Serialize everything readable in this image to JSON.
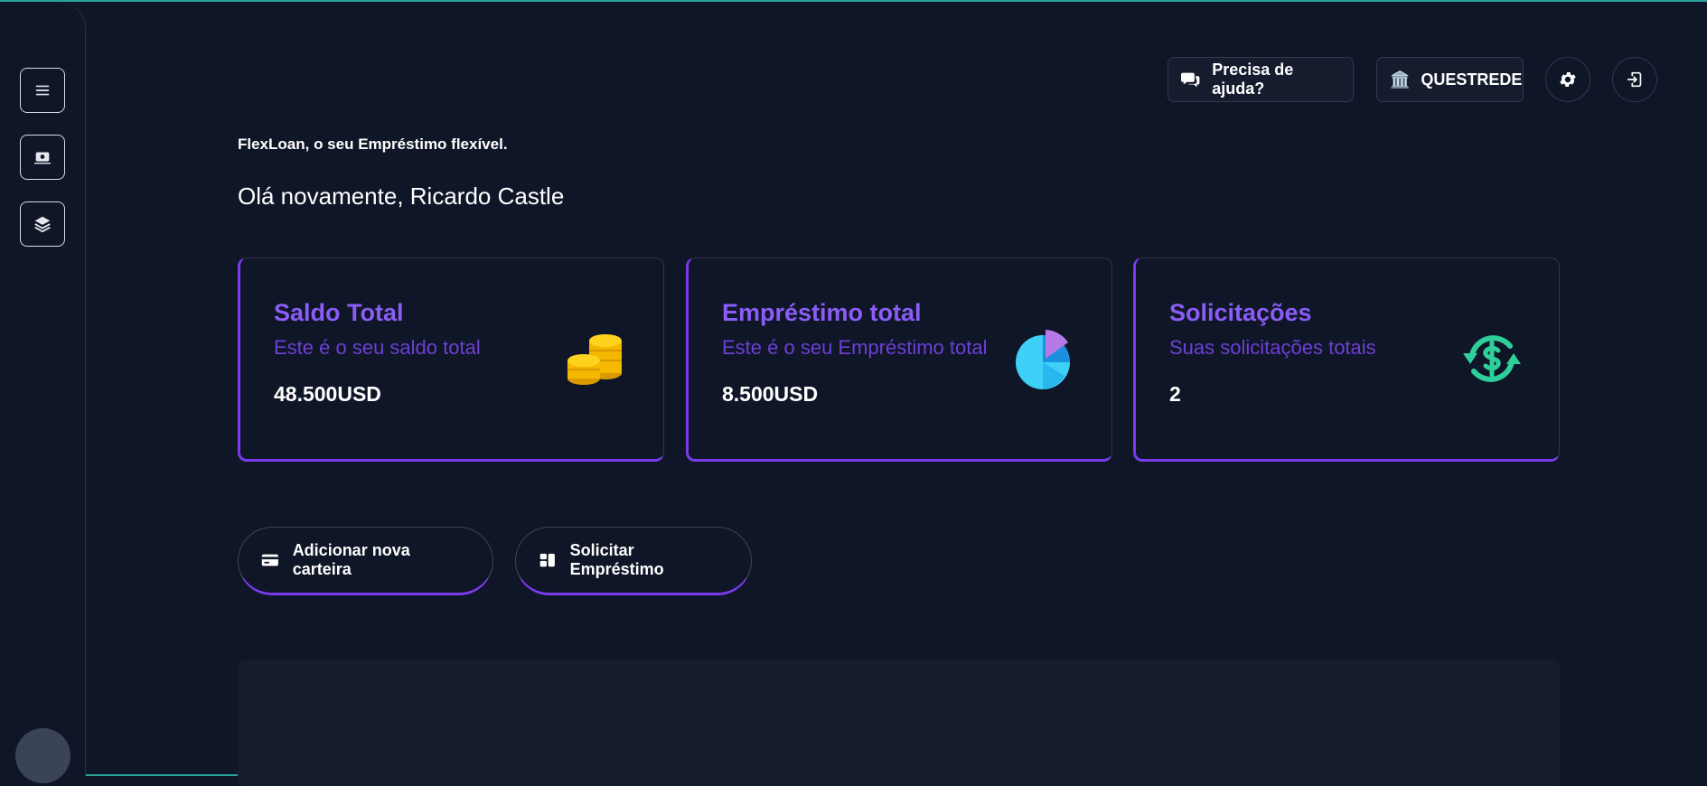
{
  "header": {
    "help_label": "Precisa de ajuda?",
    "bank_label": "QUESTREDE"
  },
  "main": {
    "tagline": "FlexLoan, o seu Empréstimo flexível.",
    "greeting": "Olá novamente, Ricardo Castle"
  },
  "cards": [
    {
      "title": "Saldo Total",
      "subtitle": "Este é o seu saldo total",
      "value": "48.500USD",
      "icon": "coins-icon"
    },
    {
      "title": "Empréstimo total",
      "subtitle": "Este é o seu Empréstimo total",
      "value": "8.500USD",
      "icon": "pie-chart-icon"
    },
    {
      "title": "Solicitações",
      "subtitle": "Suas solicitações totais",
      "value": "2",
      "icon": "dollar-refresh-icon"
    }
  ],
  "actions": {
    "add_wallet": "Adicionar nova carteira",
    "request_loan": "Solicitar Empréstimo"
  },
  "colors": {
    "accent": "#7c3aed",
    "accent_text": "#8b5cf6",
    "background": "#0f1627",
    "teal": "#2aa39a"
  }
}
